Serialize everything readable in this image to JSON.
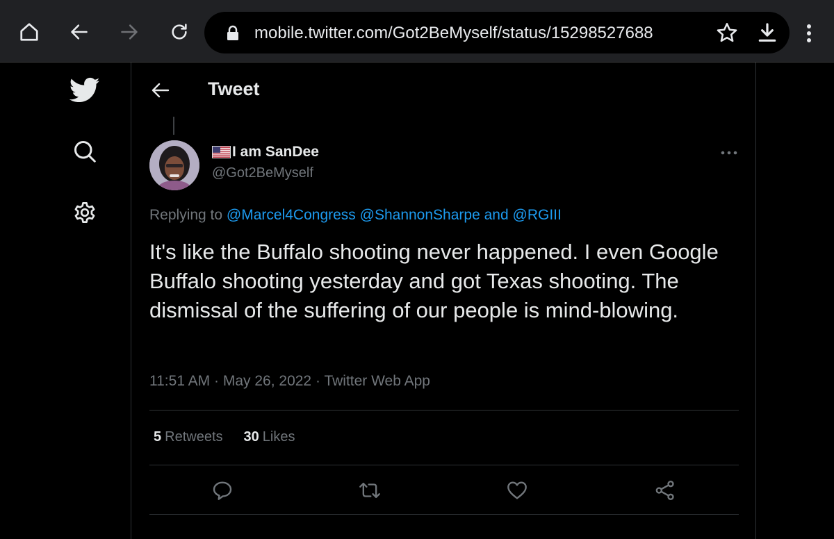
{
  "browser": {
    "url": "mobile.twitter.com/Got2BeMyself/status/15298527688"
  },
  "page": {
    "title": "Tweet"
  },
  "tweet": {
    "display_name": "I am SanDee",
    "handle": "@Got2BeMyself",
    "replying_prefix": "Replying to",
    "replying_to_1": "@Marcel4Congress",
    "replying_to_2": "@ShannonSharpe",
    "replying_and": "and",
    "replying_to_3": "@RGIII",
    "text": "It's like the Buffalo shooting never happened. I even Google Buffalo shooting yesterday and got Texas shooting. The dismissal of the suffering of our people is mind-blowing.",
    "time": "11:51 AM",
    "date": "May 26, 2022",
    "source": "Twitter Web App",
    "separator": "·",
    "retweets_count": "5",
    "retweets_label": "Retweets",
    "likes_count": "30",
    "likes_label": "Likes"
  },
  "colors": {
    "background": "#000000",
    "chrome": "#202124",
    "text_primary": "#e7e9ea",
    "text_secondary": "#71767b",
    "link": "#1d9bf0",
    "border": "#2f3336"
  },
  "icons": {
    "home": "home-icon",
    "back": "arrow-left-icon",
    "forward": "arrow-right-icon",
    "reload": "reload-icon",
    "lock": "lock-icon",
    "star": "star-icon",
    "download": "download-icon",
    "menu": "more-vertical-icon",
    "twitter": "twitter-bird-icon",
    "search": "search-icon",
    "settings": "gear-icon",
    "more": "more-horizontal-icon",
    "reply": "reply-icon",
    "retweet": "retweet-icon",
    "like": "heart-icon",
    "share": "share-icon"
  }
}
